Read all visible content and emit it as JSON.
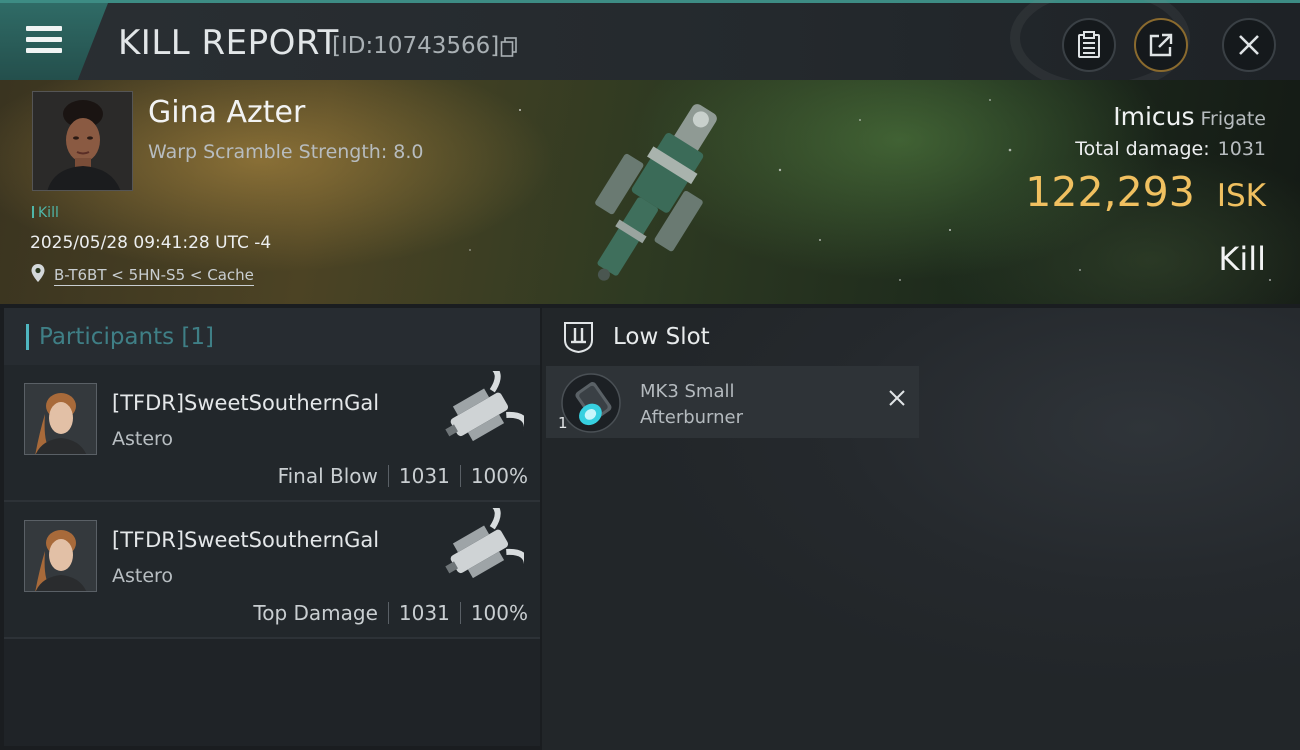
{
  "header": {
    "title": "KILL REPORT",
    "report_id": "[ID:10743566]",
    "icons": [
      "menu-icon",
      "copy-icon",
      "clipboard-icon",
      "share-icon",
      "close-icon"
    ]
  },
  "victim": {
    "name": "Gina Azter",
    "warp_scramble": "Warp Scramble Strength: 8.0",
    "kill_tag": "Kill",
    "datetime": "2025/05/28 09:41:28 UTC -4",
    "location": "B-T6BT < 5HN-S5 < Cache",
    "ship_name": "Imicus",
    "ship_class": "Frigate",
    "total_damage_label": "Total damage:",
    "total_damage": "1031",
    "isk_value": "122,293",
    "isk_unit": "ISK",
    "result": "Kill"
  },
  "participants": {
    "label": "Participants",
    "count": "[1]",
    "rows": [
      {
        "name": "[TFDR]SweetSouthernGal",
        "ship": "Astero",
        "role": "Final Blow",
        "damage": "1031",
        "percent": "100%"
      },
      {
        "name": "[TFDR]SweetSouthernGal",
        "ship": "Astero",
        "role": "Top Damage",
        "damage": "1031",
        "percent": "100%"
      }
    ]
  },
  "fitting": {
    "slot_title": "Low Slot",
    "modules": [
      {
        "qty": "1",
        "name_line1": "MK3 Small",
        "name_line2": "Afterburner"
      }
    ]
  },
  "colors": {
    "accent_teal": "#3d8c84",
    "isk_gold": "#f0c060",
    "kill_teal": "#4fb6a8"
  }
}
